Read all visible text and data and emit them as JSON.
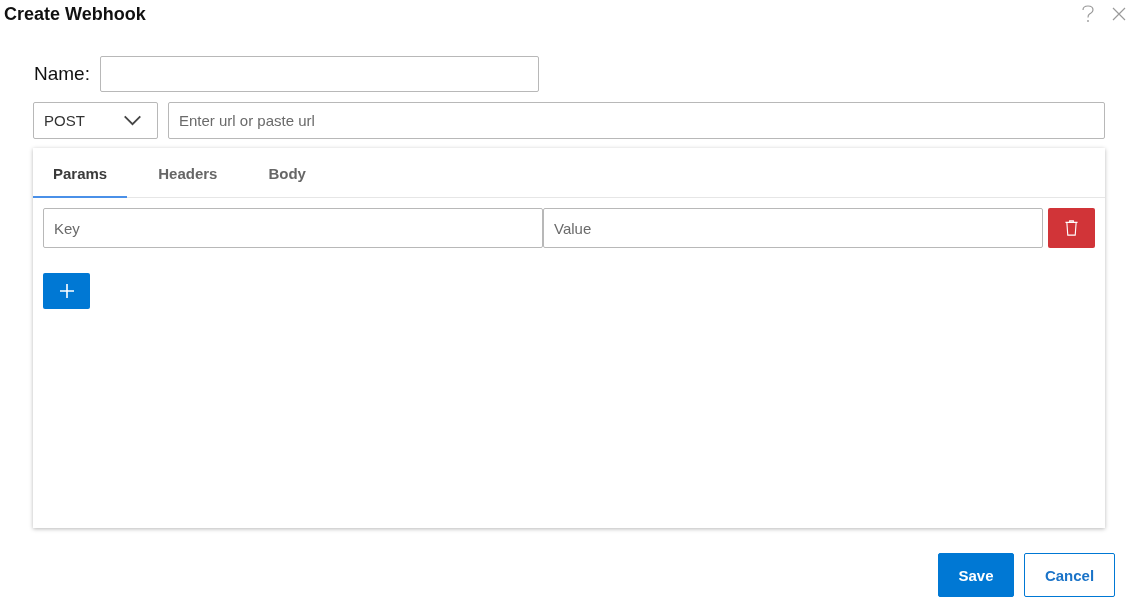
{
  "dialog": {
    "title": "Create Webhook"
  },
  "name_field": {
    "label": "Name:"
  },
  "request": {
    "method": "POST",
    "url_field": {
      "placeholder": "Enter url or paste url"
    }
  },
  "tabs": [
    {
      "label": "Params",
      "selected": true
    },
    {
      "label": "Headers",
      "selected": false
    },
    {
      "label": "Body",
      "selected": false
    }
  ],
  "params": [
    {
      "key": {
        "placeholder": "Key"
      },
      "value": {
        "placeholder": "Value"
      }
    }
  ],
  "footer_buttons": [
    {
      "label": "Save",
      "kind": "primary"
    },
    {
      "label": "Cancel",
      "kind": "secondary"
    }
  ]
}
